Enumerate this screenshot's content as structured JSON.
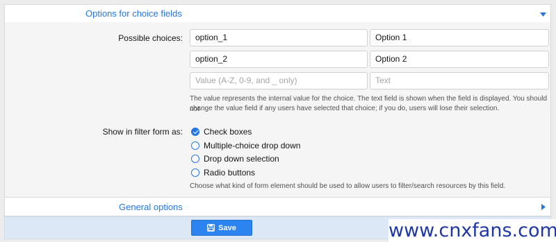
{
  "sections": {
    "choice_options": {
      "title": "Options for choice fields",
      "expanded": true
    },
    "general_options": {
      "title": "General options",
      "expanded": false
    }
  },
  "choices": {
    "label": "Possible choices:",
    "rows": [
      {
        "value": "option_1",
        "text": "Option 1"
      },
      {
        "value": "option_2",
        "text": "Option 2"
      }
    ],
    "new_row": {
      "value_placeholder": "Value (A-Z, 0-9, and _ only)",
      "text_placeholder": "Text"
    },
    "hint_line1": "The value represents the internal value for the choice. The text field is shown when the field is displayed. You should not",
    "hint_line2": "change the value field if any users have selected that choice; if you do, users will lose their selection."
  },
  "filter": {
    "label": "Show in filter form as:",
    "selected": "Check boxes",
    "options": [
      "Check boxes",
      "Multiple-choice drop down",
      "Drop down selection",
      "Radio buttons"
    ],
    "hint": "Choose what kind of form element should be used to allow users to filter/search resources by this field."
  },
  "footer": {
    "save_label": "Save"
  },
  "watermark": "www.cnxfans.com",
  "colors": {
    "accent": "#2577e3",
    "button": "#2b84f0",
    "footer_bg": "#dce8f6",
    "watermark_text": "#1e36a8"
  },
  "icons": {
    "expanded": "caret-down-icon",
    "collapsed": "caret-right-icon",
    "save": "floppy-disk-icon",
    "checked": "checkmark-icon"
  }
}
